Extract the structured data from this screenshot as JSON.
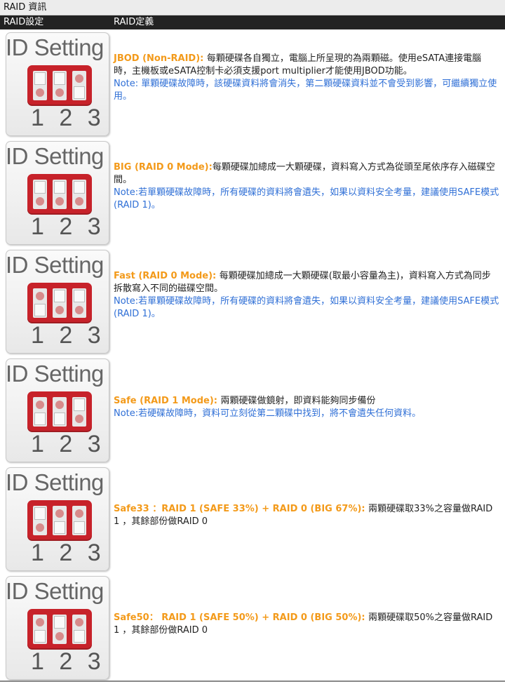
{
  "page": {
    "title": "RAID 資訊"
  },
  "columns": {
    "setting": "RAID設定",
    "definition": "RAID定義"
  },
  "rows": [
    {
      "card_title": "ID Setting",
      "card_numbers": "1 2 3",
      "switches": [
        "up",
        "up",
        "down"
      ],
      "mode": "JBOD (Non-RAID): ",
      "text": "每顆硬碟各自獨立，電腦上所呈現的為兩顆磁。使用eSATA連接電腦時，主機板或eSATA控制卡必須支援port multiplier才能使用JBOD功能。",
      "note": "Note: 單顆硬碟故障時，該硬碟資料將會消失，第二顆硬碟資料並不會受到影響，可繼續獨立使用。"
    },
    {
      "card_title": "ID Setting",
      "card_numbers": "1 2 3",
      "switches": [
        "up",
        "up",
        "up"
      ],
      "mode": "BIG (RAID 0 Mode):",
      "text": "每顆硬碟加總成一大顆硬碟，資料寫入方式為從頭至尾依序存入磁碟空間。",
      "note": "Note:若單顆硬碟故障時，所有硬碟的資料將會遺失，如果以資料安全考量，建議使用SAFE模式(RAID 1)。"
    },
    {
      "card_title": "ID Setting",
      "card_numbers": "1 2 3",
      "switches": [
        "down",
        "up",
        "up"
      ],
      "mode": "Fast (RAID 0 Mode): ",
      "text": "每顆硬碟加總成一大顆硬碟(取最小容量為主)，資料寫入方式為同步拆散寫入不同的磁碟空間。",
      "note": "Note:若單顆硬碟故障時，所有硬碟的資料將會遺失，如果以資料安全考量，建議使用SAFE模式(RAID 1)。"
    },
    {
      "card_title": "ID Setting",
      "card_numbers": "1 2 3",
      "switches": [
        "down",
        "down",
        "up"
      ],
      "mode": "Safe (RAID 1 Mode): ",
      "text": "兩顆硬碟做鏡射，即資料能夠同步備份",
      "note": "Note:若硬碟故障時，資料可立刻從第二顆碟中找到，將不會遺失任何資料。"
    },
    {
      "card_title": "ID Setting",
      "card_numbers": "1 2 3",
      "switches": [
        "up",
        "down",
        "down"
      ],
      "mode": "Safe33 ：RAID 1 (SAFE 33%) + RAID 0 (BIG 67%): ",
      "text": "兩顆硬碟取33%之容量做RAID 1 ，其餘部份做RAID 0",
      "note": ""
    },
    {
      "card_title": "ID Setting",
      "card_numbers": "1 2 3",
      "switches": [
        "down",
        "up",
        "down"
      ],
      "mode": "Safe50： RAID 1 (SAFE 50%) + RAID 0 (BIG 50%): ",
      "text": "兩顆硬碟取50%之容量做RAID 1 ，其餘部份做RAID 0",
      "note": ""
    }
  ]
}
